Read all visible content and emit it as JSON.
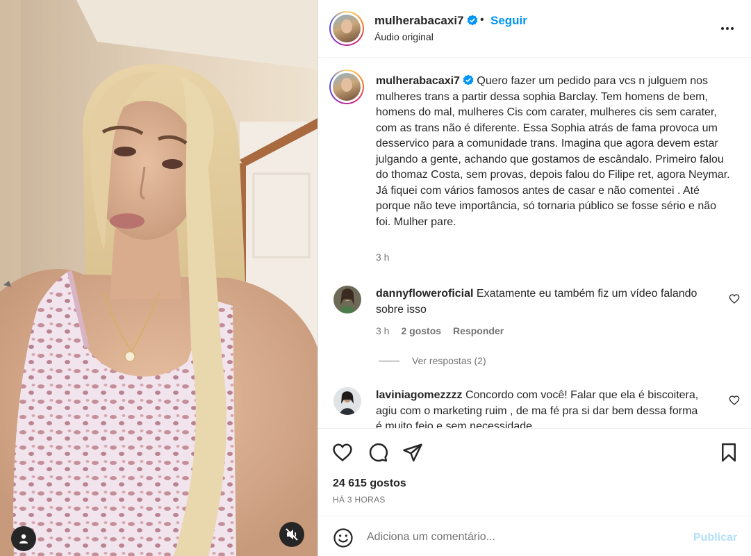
{
  "colors": {
    "accent": "#0095f6",
    "text": "#262626",
    "muted": "#737373",
    "publish_disabled": "#b2dffc"
  },
  "media": {
    "tag_icon": "user-tag-icon",
    "mute_icon": "speaker-muted-icon"
  },
  "header": {
    "username": "mulherabacaxi7",
    "verified_icon": "verified-badge-icon",
    "separator": "•",
    "follow_label": "Seguir",
    "subtitle": "Áudio original",
    "more_icon": "more-options-icon"
  },
  "caption": {
    "username": "mulherabacaxi7",
    "text": "Quero fazer um pedido para vcs n julguem nos mulheres trans a partir dessa sophia Barclay. Tem homens de bem, homens do mal, mulheres Cis com carater, mulheres cis sem carater, com as trans não é diferente. Essa Sophia atrás de fama provoca um desservico para a comunidade trans. Imagina que agora devem estar julgando a gente, achando que gostamos de escândalo. Primeiro falou do thomaz Costa, sem provas, depois falou do Filipe ret, agora Neymar. Já fiquei com vários famosos antes de casar e não comentei . Até porque não teve importância, só tornaria público se fosse sério e não foi. Mulher pare.",
    "time": "3 h"
  },
  "comments": [
    {
      "username": "dannyfloweroficial",
      "text": "Exatamente eu também fiz um vídeo falando sobre isso",
      "time": "3 h",
      "likes": "2 gostos",
      "reply_label": "Responder",
      "view_replies": "Ver respostas (2)"
    },
    {
      "username": "laviniagomezzzz",
      "text": "Concordo com você! Falar que ela é biscoitera, agiu com o marketing ruim , de ma fé pra si dar bem dessa forma é muito feio e sem necessidade"
    }
  ],
  "actions": {
    "like_icon": "heart-icon",
    "comment_icon": "comment-icon",
    "share_icon": "share-icon",
    "save_icon": "bookmark-icon",
    "likes_count": "24 615 gostos",
    "posted_ago": "HÁ 3 HORAS"
  },
  "add_comment": {
    "emoji_icon": "emoji-icon",
    "placeholder": "Adiciona um comentário...",
    "publish_label": "Publicar"
  }
}
